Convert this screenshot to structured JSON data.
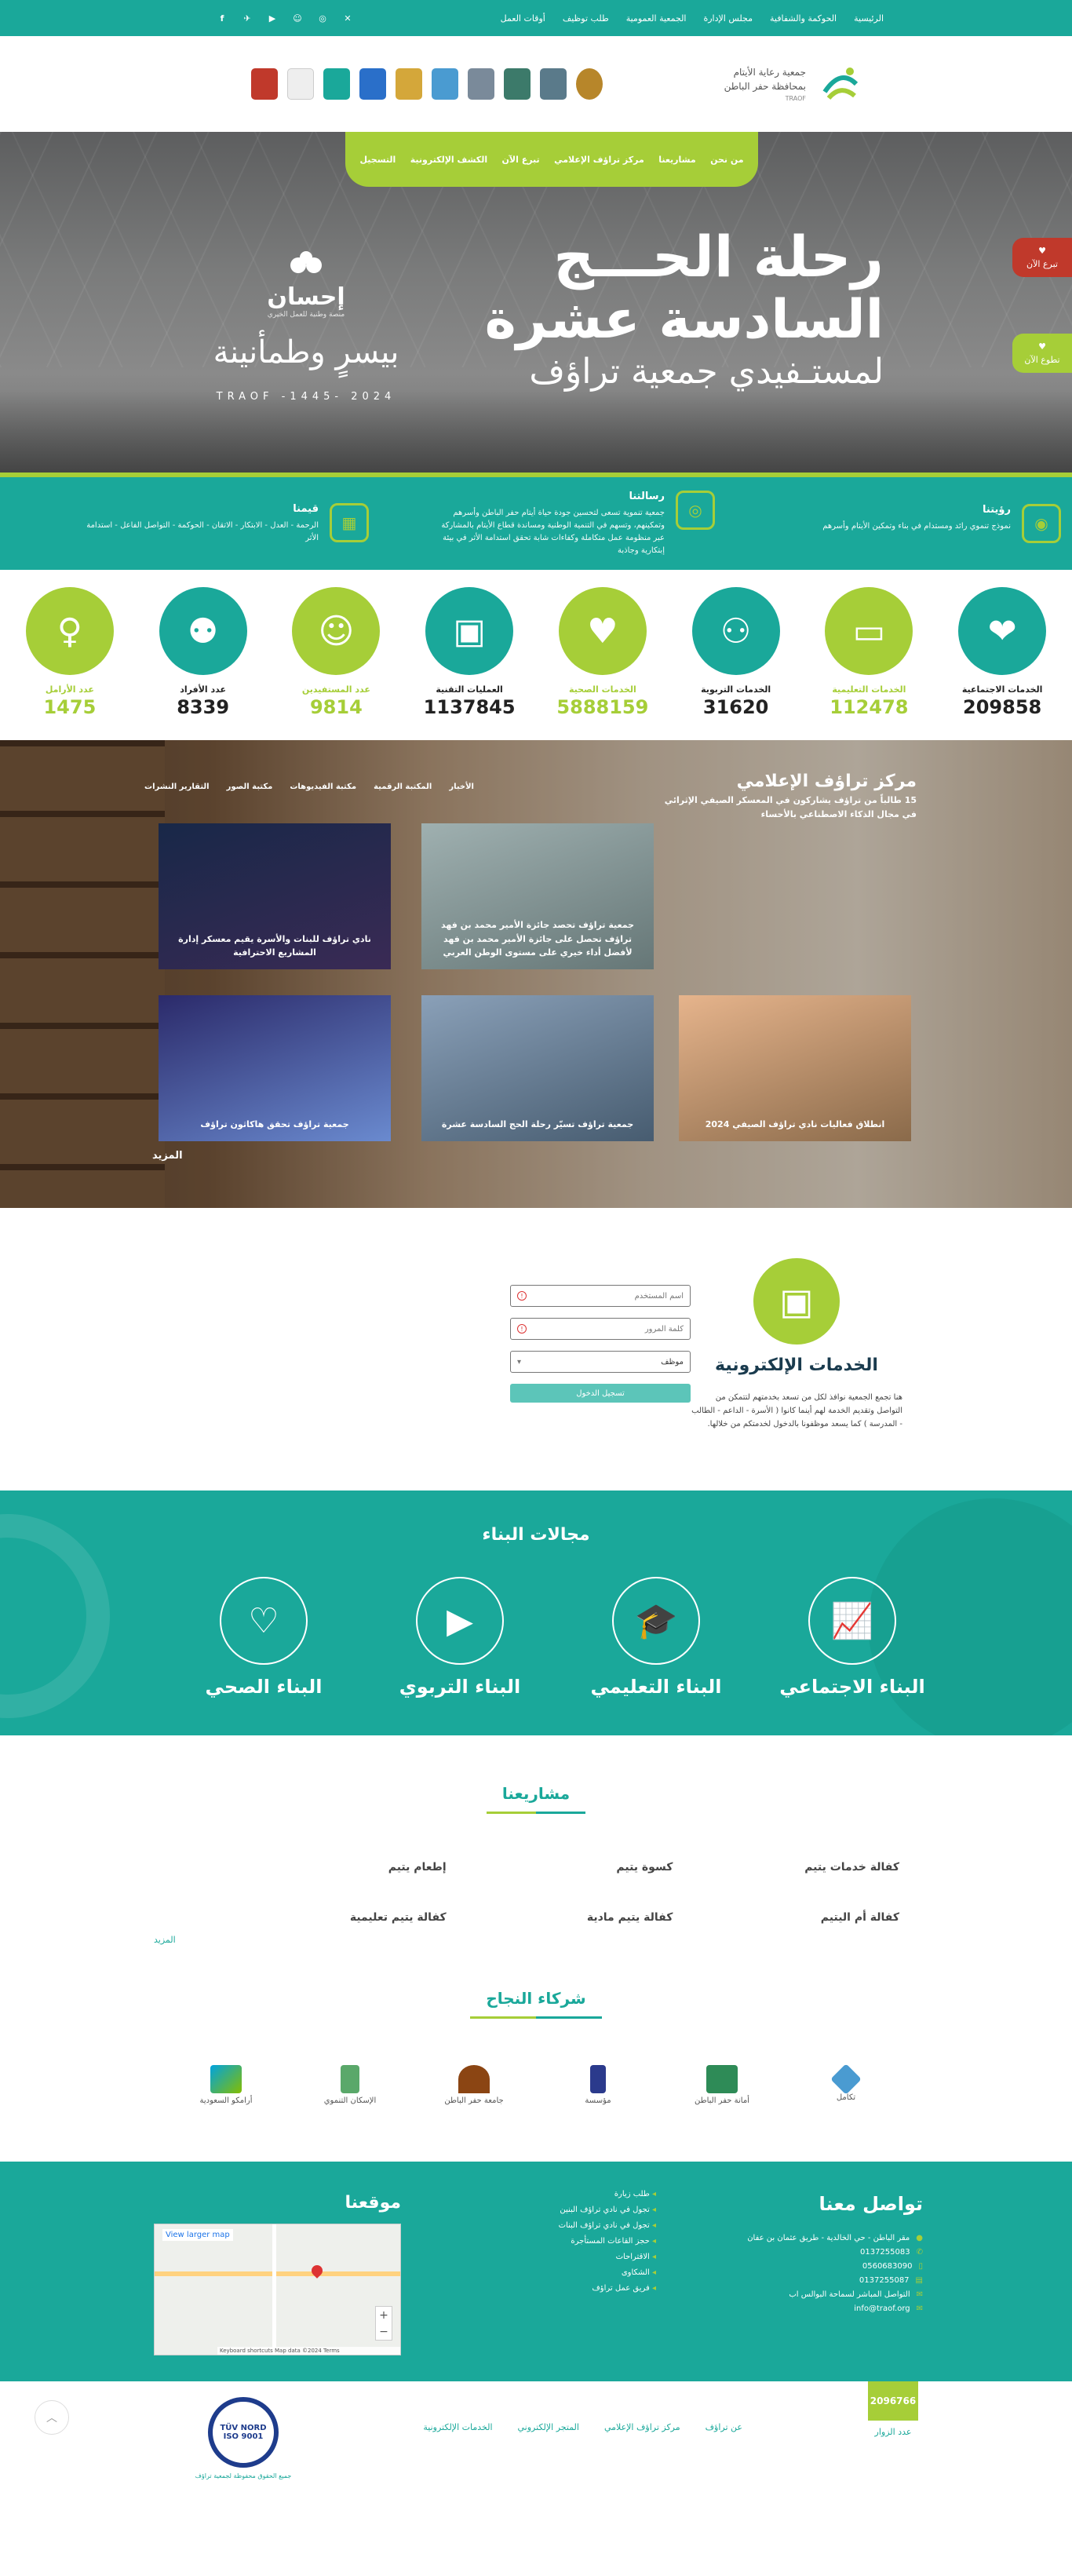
{
  "topbar": {
    "nav": [
      "الرئيسية",
      "الحوكمة والشفافية",
      "مجلس الإدارة",
      "الجمعية العمومية",
      "طلب توظيف",
      "أوقات العمل"
    ],
    "social": [
      "facebook-icon",
      "telegram-icon",
      "youtube-icon",
      "snapchat-icon",
      "instagram-icon",
      "x-icon"
    ]
  },
  "header": {
    "org_name_line1": "جمعية رعاية الأيتام",
    "org_name_line2": "بمحافظة حفر الباطن",
    "org_tagline": "TRAOF",
    "logo_text": "تراؤف"
  },
  "mainnav": [
    "من نحن",
    "مشاريعنا",
    "مركز تراؤف الإعلامي",
    "تبرع الآن",
    "الكشف الإلكترونية",
    "التسجيل"
  ],
  "hero": {
    "title_line1": "رحلة الحـــج",
    "title_line2": "السادسة عشرة",
    "title_line3": "لمستـفيدي جمعية تراؤف",
    "ihsan_name": "إحسان",
    "ihsan_sub": "منصة وطنية للعمل الخيري",
    "calligraphy": "بيسرٍ وطمأنينة",
    "year": "TRAOF -1445- 2024",
    "donate_btn": "تبرع الآن",
    "volunteer_btn": "تطوع الآن"
  },
  "vision": {
    "items": [
      {
        "title": "رؤيتنا",
        "text": "نموذج تنموي رائد ومستدام في بناء وتمكين الأيتام وأسرهم"
      },
      {
        "title": "رسالتنا",
        "text": "جمعية تنموية تسعى لتحسين جودة حياة أيتام حفر الباطن وأسرهم وتمكينهم، وتسهم في التنمية الوطنية ومساندة قطاع الأيتام بالمشاركة عبر منظومة عمل متكاملة وكفاءات شابة تحقق استدامة الأثر في بيئة إبتكارية وجاذبة"
      },
      {
        "title": "قيمنا",
        "text": "الرحمة - العدل - الابتكار - الاتقان - الحوكمة - التواصل الفاعل - استدامة الأثر"
      }
    ]
  },
  "stats": [
    {
      "label": "الخدمات الاجتماعية",
      "value": "209858",
      "icon": "hand-heart-icon",
      "tone": "t"
    },
    {
      "label": "الخدمات التعليمية",
      "value": "112478",
      "icon": "teacher-icon",
      "tone": "g"
    },
    {
      "label": "الخدمات التربوية",
      "value": "31620",
      "icon": "parent-child-icon",
      "tone": "t"
    },
    {
      "label": "الخدمات الصحية",
      "value": "5888159",
      "icon": "heart-pulse-icon",
      "tone": "g"
    },
    {
      "label": "العمليات التقنية",
      "value": "1137845",
      "icon": "monitor-icon",
      "tone": "t"
    },
    {
      "label": "عدد المستفيدين",
      "value": "9814",
      "icon": "family-icon",
      "tone": "g"
    },
    {
      "label": "عدد الأفراد",
      "value": "8339",
      "icon": "group-icon",
      "tone": "t"
    },
    {
      "label": "عدد الأرامل",
      "value": "1475",
      "icon": "woman-icon",
      "tone": "g"
    }
  ],
  "media": {
    "title": "مركز تراؤف الإعلامي",
    "ticker": "15 طالباً من تراؤف يشاركون في المعسكر الصيفي الإثرائي في مجال الذكاء الاصطناعي بالأحساء",
    "tabs": [
      "الأخبار",
      "المكتبة الرقمية",
      "مكتبة الفيديوهات",
      "مكتبة الصور",
      "التقارير النشرات"
    ],
    "cards": [
      "جمعية تراؤف تحصد جائزة الأمير محمد بن فهد تراؤف تحصل على جائزة الأمير محمد بن فهد لأفضل أداء خيري على مستوى الوطن العربي",
      "نادي تراؤف للبنات والأسرة يقيم معسكر إدارة المشاريع الاحترافية",
      "انطلاق فعاليات نادي تراؤف الصيفي 2024",
      "جمعية تراؤف تسيّر رحلة الحج السادسة عشرة",
      "جمعية تراؤف تحقق هاكاثون تراؤف"
    ],
    "more": "المزيد"
  },
  "eservices": {
    "title": "الخدمات الإلكترونية",
    "text": "هنا تجمع الجمعية نوافذ لكل من تسعد بخدمتهم لتتمكن من التواصل وتقديم الخدمة لهم أينما كانوا ( الأسرة - الداعم - الطالب - المدرسة ) كما يسعد موظفونا بالدخول لخدمتكم من خلالها.",
    "username_ph": "اسم المستخدم",
    "password_ph": "كلمة المرور",
    "role": "موظف",
    "login": "تسجيل الدخول"
  },
  "fields": {
    "title": "مجالات البناء",
    "items": [
      {
        "label": "البناء الاجتماعي",
        "icon": "chart-monitor-icon"
      },
      {
        "label": "البناء التعليمي",
        "icon": "graduation-icon"
      },
      {
        "label": "البناء التربوي",
        "icon": "video-screen-icon"
      },
      {
        "label": "البناء الصحي",
        "icon": "heartbeat-icon"
      }
    ]
  },
  "projects": {
    "title": "مشاريعنا",
    "items": [
      "كفالة خدمات يتيم",
      "كسوة يتيم",
      "إطعام يتيم",
      "كفالة أم اليتيم",
      "كفالة يتيم مادية",
      "كفالة يتيم تعليمية"
    ],
    "more": "المزيد"
  },
  "partners": {
    "title": "شركاء النجاح",
    "items": [
      "تكامل",
      "أمانة حفر الباطن",
      "مؤسسة",
      "جامعة حفر الباطن",
      "الإسكان التنموي",
      "أرامكو السعودية"
    ]
  },
  "footer": {
    "contact_title": "تواصل معنا",
    "contact": [
      "مقر الباطن - حي الخالدية - طريق عثمان بن عفان",
      "0137255083",
      "0560683090",
      "0137255087",
      "التواصل المباشر لسماحة البوالس اب",
      "info@traof.org"
    ],
    "links": [
      "طلب زيارة",
      "تجول في نادي تراؤف البنين",
      "تجول في نادي تراؤف البنات",
      "حجز القاعات المستأجرة",
      "الاقتراحات",
      "الشكاوى",
      "فريق عمل تراؤف"
    ],
    "map_title": "موقعنا",
    "map_view": "View larger map",
    "map_credits": "Keyboard shortcuts  Map data ©2024  Terms"
  },
  "bottombar": {
    "visitor_count": "2096766",
    "visitor_label": "عدد الزوار",
    "nav": [
      "عن تراؤف",
      "مركز تراؤف الإعلامي",
      "المتجر الإلكتروني",
      "الخدمات الإلكترونية"
    ],
    "iso_label": "TÜV NORD",
    "iso_num": "ISO 9001",
    "iso_caption": "جميع الحقوق محفوظة لجمعية تراؤف"
  },
  "colors": {
    "teal": "#1aa89a",
    "lime": "#a6ce38",
    "donate": "#c0392b"
  }
}
